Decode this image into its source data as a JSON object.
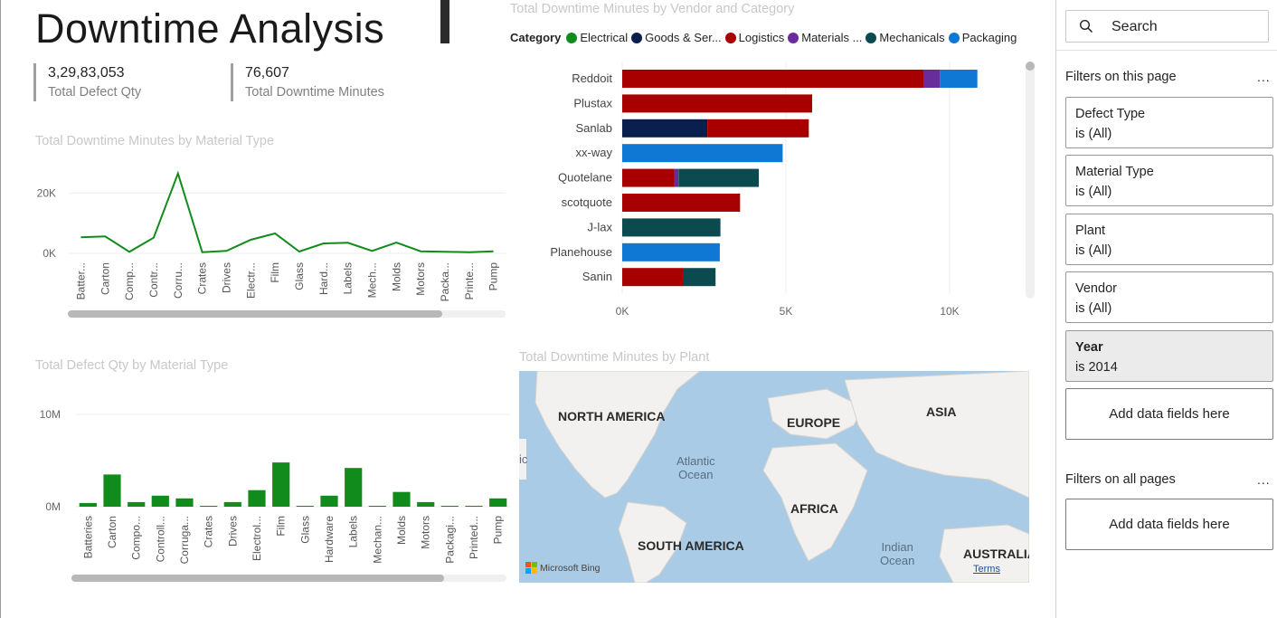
{
  "report": {
    "title": "Downtime Analysis"
  },
  "kpis": [
    {
      "value": "3,29,83,053",
      "label": "Total Defect Qty"
    },
    {
      "value": "76,607",
      "label": "Total Downtime Minutes"
    }
  ],
  "charts": {
    "vendor_title": "Total Downtime Minutes by Vendor and Category",
    "line_title": "Total Downtime Minutes by Material Type",
    "bar_title": "Total Defect Qty by Material Type",
    "map_title": "Total Downtime Minutes by Plant"
  },
  "legend": {
    "label": "Category",
    "items": [
      {
        "name": "Electrical",
        "color": "#118b1c"
      },
      {
        "name": "Goods & Ser...",
        "color": "#0b1f4f"
      },
      {
        "name": "Logistics",
        "color": "#a80000"
      },
      {
        "name": "Materials ...",
        "color": "#6a2c9b"
      },
      {
        "name": "Mechanicals",
        "color": "#0b4a4f"
      },
      {
        "name": "Packaging",
        "color": "#0f78d4"
      }
    ]
  },
  "chart_data": [
    {
      "type": "line",
      "title": "Total Downtime Minutes by Material Type",
      "categories": [
        "Batter...",
        "Carton",
        "Comp...",
        "Contr...",
        "Corru...",
        "Crates",
        "Drives",
        "Electr...",
        "Film",
        "Glass",
        "Hard...",
        "Labels",
        "Mech...",
        "Molds",
        "Motors",
        "Packa...",
        "Printe...",
        "Pump"
      ],
      "values": [
        5300,
        5600,
        500,
        5200,
        26500,
        400,
        800,
        4500,
        6600,
        600,
        3300,
        3500,
        800,
        3600,
        700,
        500,
        400,
        700
      ],
      "yticks": [
        "20K",
        "0K"
      ],
      "ylim": [
        0,
        30000
      ],
      "color": "#118b1c"
    },
    {
      "type": "bar",
      "title": "Total Defect Qty by Material Type",
      "categories": [
        "Batteries",
        "Carton",
        "Compo...",
        "Controll...",
        "Corruga...",
        "Crates",
        "Drives",
        "Electrol...",
        "Film",
        "Glass",
        "Hardware",
        "Labels",
        "Mechan...",
        "Molds",
        "Motors",
        "Packagi...",
        "Printed...",
        "Pump"
      ],
      "values": [
        400000,
        3500000,
        500000,
        1200000,
        900000,
        100000,
        500000,
        1800000,
        4800000,
        100000,
        1200000,
        4200000,
        100000,
        1600000,
        500000,
        100000,
        100000,
        900000
      ],
      "yticks": [
        "10M",
        "0M"
      ],
      "ylim": [
        0,
        11000000
      ],
      "color": "#118b1c"
    },
    {
      "type": "bar",
      "title": "Total Downtime Minutes by Vendor and Category",
      "orientation": "horizontal-stacked",
      "categories": [
        "Reddoit",
        "Plustax",
        "Sanlab",
        "xx-way",
        "Quotelane",
        "scotquote",
        "J-lax",
        "Planehouse",
        "Sanin"
      ],
      "series": [
        {
          "name": "Goods & Ser...",
          "values": [
            0,
            0,
            2600,
            0,
            0,
            0,
            0,
            0,
            0
          ]
        },
        {
          "name": "Logistics",
          "values": [
            9200,
            5800,
            3100,
            0,
            1600,
            3600,
            0,
            0,
            1850
          ]
        },
        {
          "name": "Materials ...",
          "values": [
            500,
            0,
            0,
            0,
            120,
            0,
            0,
            0,
            0
          ]
        },
        {
          "name": "Mechanicals",
          "values": [
            0,
            0,
            0,
            0,
            2450,
            0,
            3000,
            0,
            1000
          ]
        },
        {
          "name": "Packaging",
          "values": [
            1150,
            0,
            0,
            4900,
            0,
            0,
            0,
            2980,
            0
          ]
        }
      ],
      "xticks": [
        "0K",
        "5K",
        "10K"
      ],
      "xlim": [
        0,
        12000
      ],
      "colors": {
        "Goods & Ser...": "#0b1f4f",
        "Logistics": "#a80000",
        "Materials ...": "#6a2c9b",
        "Mechanicals": "#0b4a4f",
        "Packaging": "#0f78d4"
      }
    }
  ],
  "map": {
    "continents": [
      "NORTH AMERICA",
      "EUROPE",
      "ASIA",
      "AFRICA",
      "SOUTH AMERICA",
      "AUSTRALIA"
    ],
    "oceans": [
      "Atlantic\nOcean",
      "Indian\nOcean"
    ],
    "edge_text": "ic",
    "attribution": "Microsoft Bing",
    "terms": "Terms"
  },
  "filters": {
    "search_placeholder": "Search",
    "this_page_title": "Filters on this page",
    "all_pages_title": "Filters on all pages",
    "more": "...",
    "cards": [
      {
        "name": "Defect Type",
        "state": "is (All)"
      },
      {
        "name": "Material Type",
        "state": "is (All)"
      },
      {
        "name": "Plant",
        "state": "is (All)"
      },
      {
        "name": "Vendor",
        "state": "is (All)"
      },
      {
        "name": "Year",
        "state": "is 2014"
      }
    ],
    "add_label": "Add data fields here"
  }
}
